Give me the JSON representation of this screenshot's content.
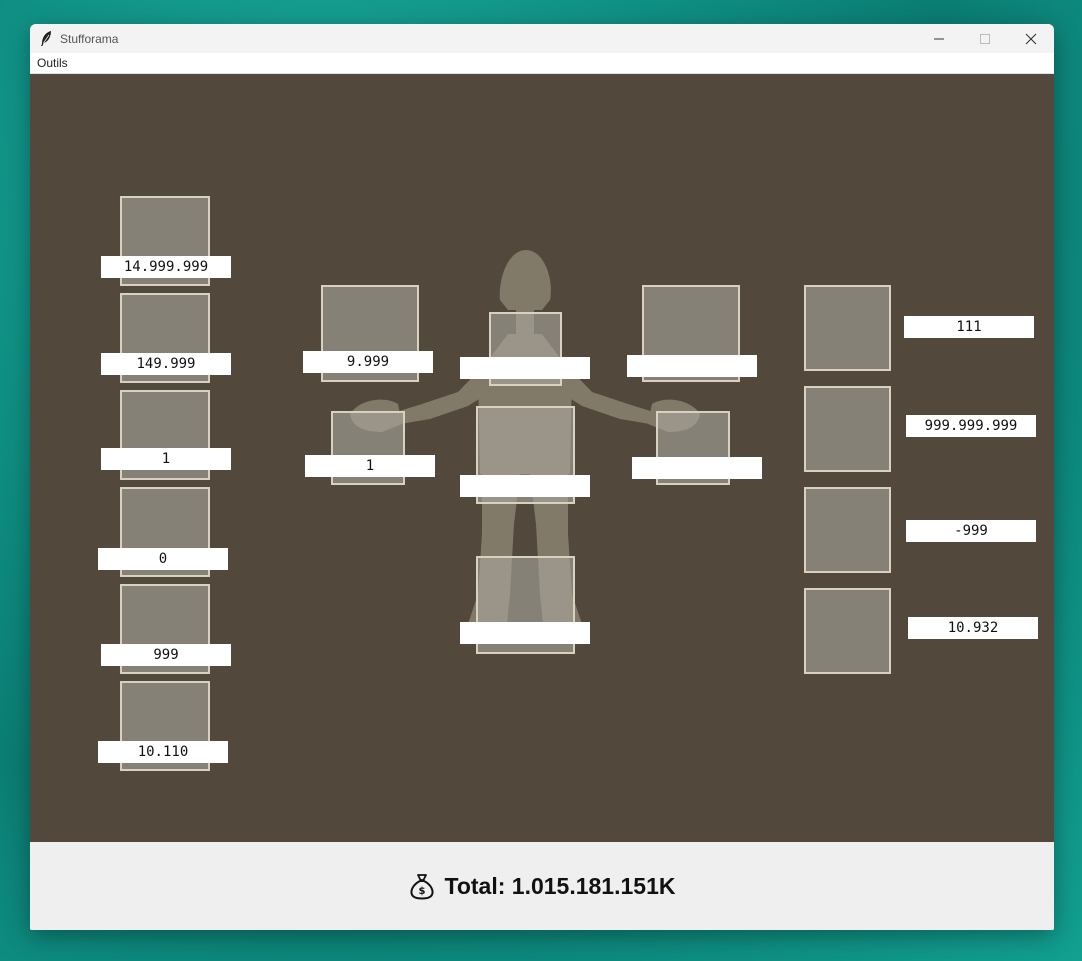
{
  "window": {
    "title": "Stufforama",
    "menu": [
      "Outils"
    ]
  },
  "colors": {
    "canvas_bg": "#52493c",
    "slot_border": "#d8d1c0",
    "footer_bg": "#efefef"
  },
  "icons": {
    "app": "feather-icon",
    "footer": "money-bag-icon"
  },
  "left_column": [
    "14.999.999",
    "149.999",
    "1",
    "0",
    "999",
    "10.110"
  ],
  "center": {
    "head_left": "9.999",
    "head": "",
    "head_right": "",
    "hand_left": "1",
    "chest": "",
    "hand_right": "",
    "legs": ""
  },
  "right_column": [
    "111",
    "999.999.999",
    "-999",
    "10.932"
  ],
  "footer": {
    "total_text": "Total: 1.015.181.151K"
  }
}
